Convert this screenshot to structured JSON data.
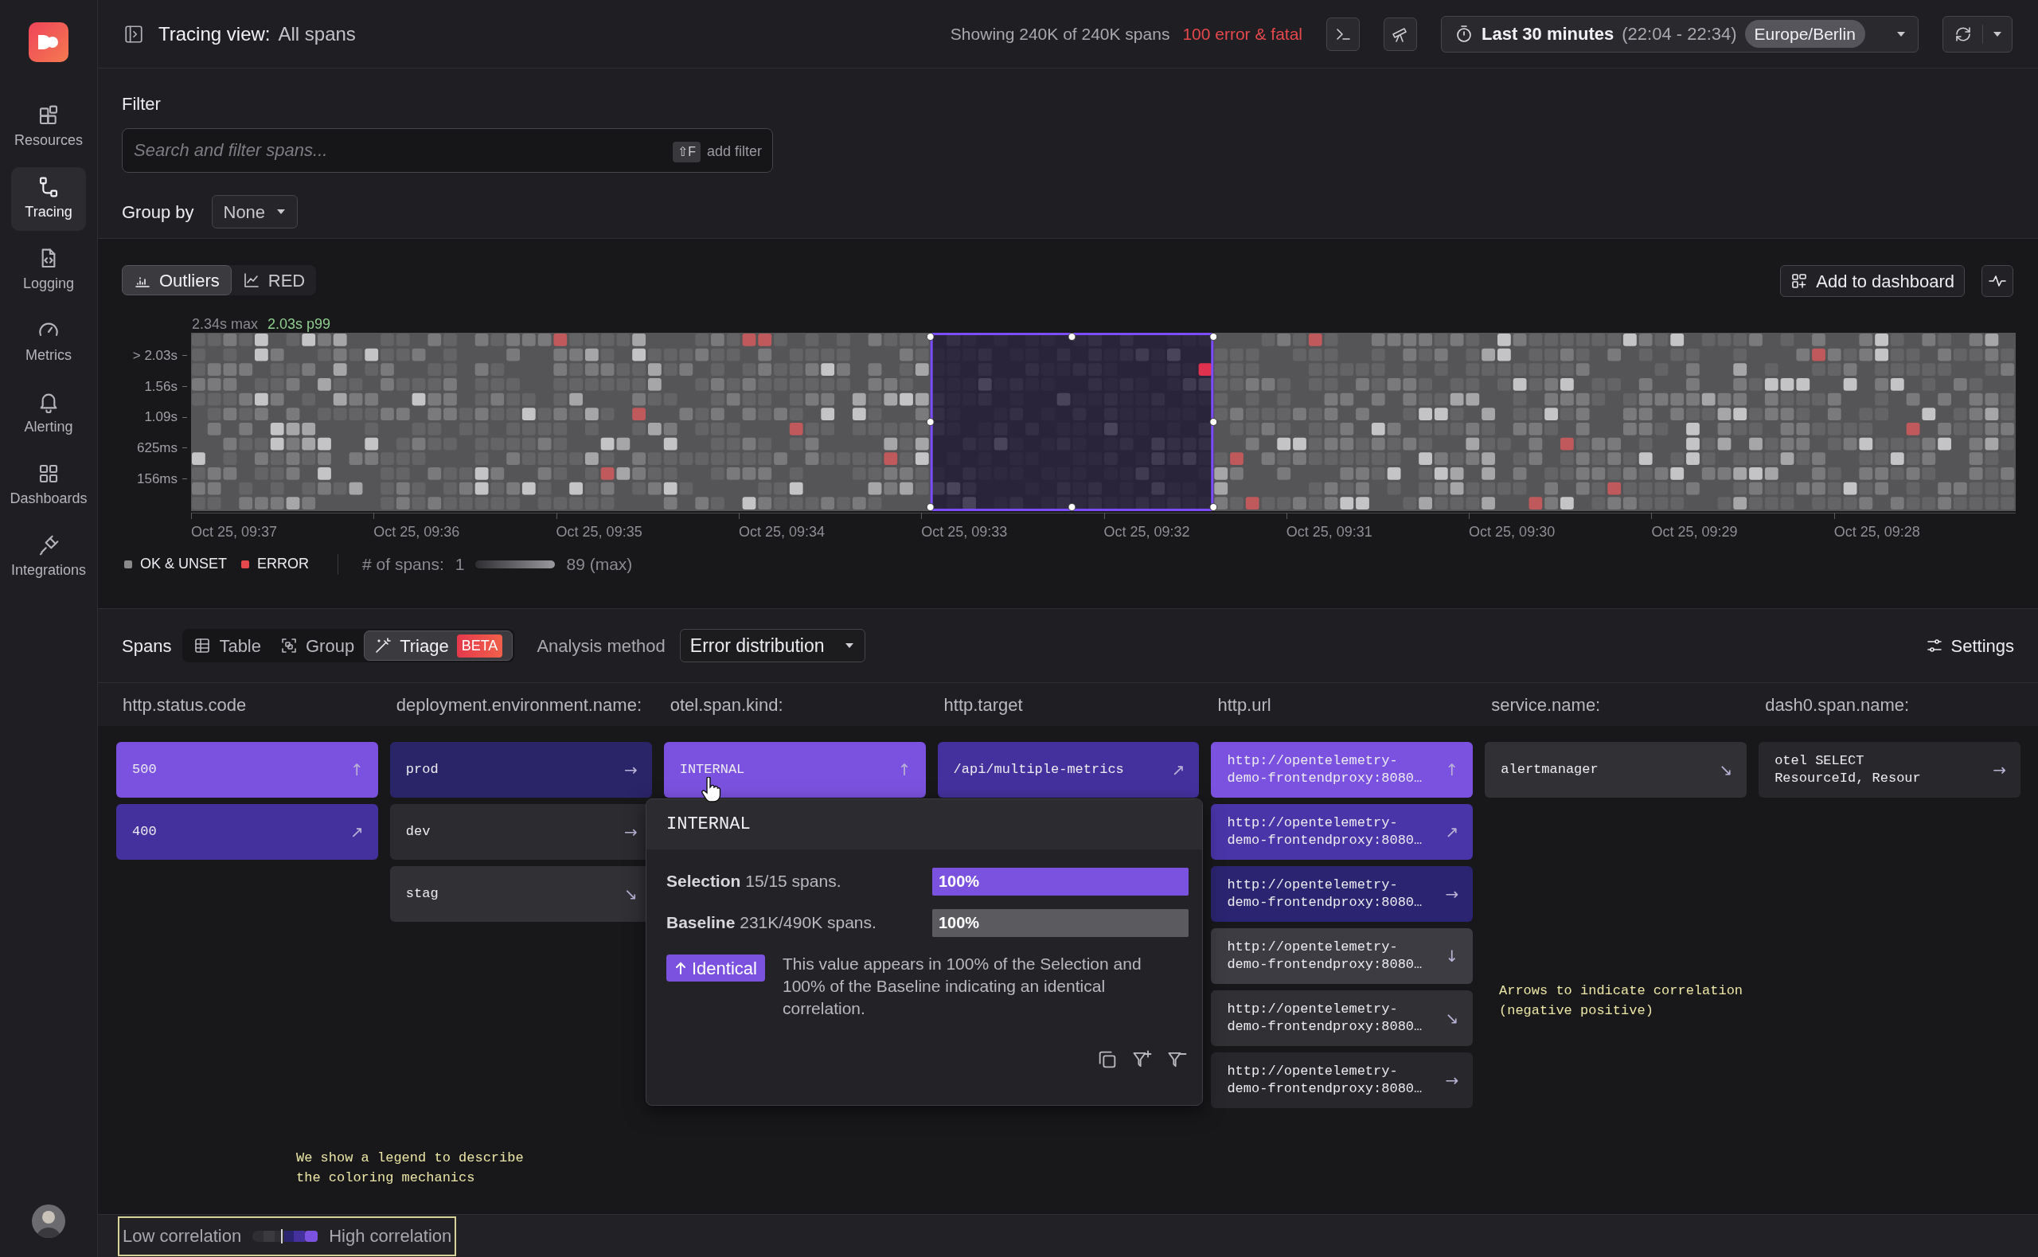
{
  "sidebar": {
    "items": [
      {
        "label": "Resources",
        "selected": false
      },
      {
        "label": "Tracing",
        "selected": true
      },
      {
        "label": "Logging",
        "selected": false
      },
      {
        "label": "Metrics",
        "selected": false
      },
      {
        "label": "Alerting",
        "selected": false
      },
      {
        "label": "Dashboards",
        "selected": false
      },
      {
        "label": "Integrations",
        "selected": false
      }
    ]
  },
  "top_bar": {
    "title": "Tracing view:",
    "view": "All spans",
    "summary": "Showing 240K of 240K spans",
    "errors": "100 error & fatal",
    "time_range": {
      "label": "Last 30 minutes",
      "range": "(22:04 - 22:34)",
      "timezone": "Europe/Berlin"
    }
  },
  "filter": {
    "label": "Filter",
    "placeholder": "Search and filter spans...",
    "shortcut": "⇧F",
    "hint": "add filter"
  },
  "group_by": {
    "label": "Group by",
    "value": "None"
  },
  "chart": {
    "tabs": [
      {
        "label": "Outliers",
        "selected": true
      },
      {
        "label": "RED",
        "selected": false
      }
    ],
    "add_to_dashboard": "Add to dashboard",
    "max": "2.34s max",
    "p99": "2.03s p99",
    "y_labels": [
      "> 2.03s",
      "1.56s",
      "1.09s",
      "625ms",
      "156ms"
    ],
    "x_labels": [
      "Oct 25, 09:37",
      "Oct 25, 09:36",
      "Oct 25, 09:35",
      "Oct 25, 09:34",
      "Oct 25, 09:33",
      "Oct 25, 09:32",
      "Oct 25, 09:31",
      "Oct 25, 09:30",
      "Oct 25, 09:29",
      "Oct 25, 09:28"
    ],
    "legend": [
      {
        "label": "OK & UNSET",
        "color": "#8a8a8a"
      },
      {
        "label": "ERROR",
        "color": "#e5484d"
      }
    ],
    "count_label": "# of spans:",
    "count_min": "1",
    "count_max": "89 (max)"
  },
  "spans": {
    "title": "Spans",
    "views": [
      {
        "label": "Table",
        "selected": false
      },
      {
        "label": "Group",
        "selected": false
      },
      {
        "label": "Triage",
        "selected": true,
        "badge": "BETA"
      }
    ],
    "analysis_label": "Analysis method",
    "analysis_value": "Error distribution",
    "settings": "Settings",
    "columns": [
      {
        "header": "http.status.code",
        "values": [
          {
            "text": "500",
            "color": "#7b52e0",
            "arrow": "↑"
          },
          {
            "text": "400",
            "color": "#45319e",
            "arrow": "↗"
          }
        ]
      },
      {
        "header": "deployment.environment.name:",
        "values": [
          {
            "text": "prod",
            "color": "#2a2468",
            "arrow": "→"
          },
          {
            "text": "dev",
            "color": "#2b2b30",
            "arrow": "→"
          },
          {
            "text": "stag",
            "color": "#303035",
            "arrow": "↘"
          }
        ]
      },
      {
        "header": "otel.span.kind:",
        "values": [
          {
            "text": "INTERNAL",
            "color": "#7b52e0",
            "arrow": "↑"
          }
        ]
      },
      {
        "header": "http.target",
        "values": [
          {
            "text": "/api/multiple-metrics",
            "color": "#45319e",
            "arrow": "↗"
          }
        ]
      },
      {
        "header": "http.url",
        "values": [
          {
            "text": "http://opentelemetry-\ndemo-frontendproxy:8080…",
            "color": "#7b52e0",
            "arrow": "↑"
          },
          {
            "text": "http://opentelemetry-\ndemo-frontendproxy:8080…",
            "color": "#4a35a8",
            "arrow": "↗"
          },
          {
            "text": "http://opentelemetry-\ndemo-frontendproxy:8080…",
            "color": "#2b2470",
            "arrow": "→"
          },
          {
            "text": "http://opentelemetry-\ndemo-frontendproxy:8080…",
            "color": "#3c3c42",
            "arrow": "↓"
          },
          {
            "text": "http://opentelemetry-\ndemo-frontendproxy:8080…",
            "color": "#303035",
            "arrow": "↘"
          },
          {
            "text": "http://opentelemetry-\ndemo-frontendproxy:8080…",
            "color": "#28282c",
            "arrow": "→"
          }
        ]
      },
      {
        "header": "service.name:",
        "values": [
          {
            "text": "alertmanager",
            "color": "#303035",
            "arrow": "↘"
          }
        ]
      },
      {
        "header": "dash0.span.name:",
        "values": [
          {
            "text": "otel SELECT\nResourceId, Resour",
            "color": "#28282c",
            "arrow": "→"
          }
        ]
      }
    ]
  },
  "tooltip": {
    "title": "INTERNAL",
    "rows": [
      {
        "kind": "selection",
        "label": "Selection",
        "detail": "15/15 spans.",
        "value": "100%",
        "level": 1
      },
      {
        "kind": "baseline",
        "label": "Baseline",
        "detail": "231K/490K spans.",
        "value": "100%",
        "level": 1
      }
    ],
    "badge": "Identical",
    "description": "This value appears in 100% of the Selection and 100% of the Baseline indicating an identical correlation."
  },
  "annotations": [
    {
      "text": "We show a legend to describe\nthe coloring mechanics"
    },
    {
      "text": "Arrows to indicate correlation\n(negative positive)"
    }
  ],
  "correlation_legend": {
    "low": "Low correlation",
    "high": "High correlation"
  }
}
